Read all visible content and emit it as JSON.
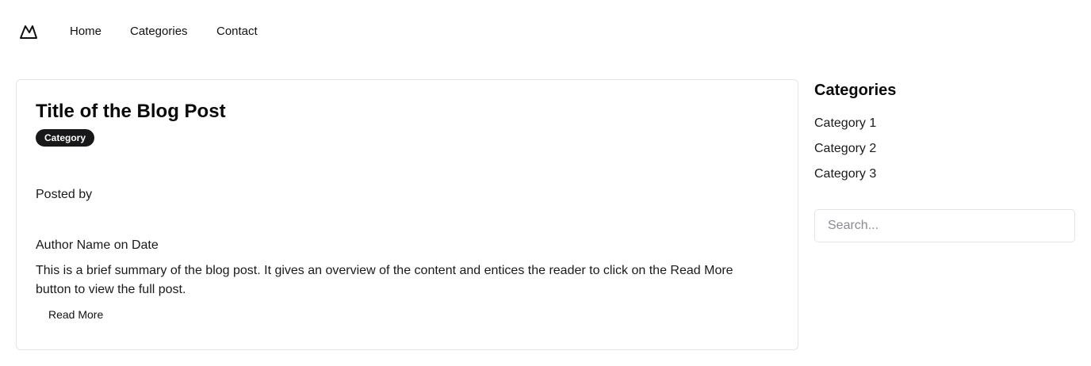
{
  "nav": {
    "logo_icon": "mountain-logo-icon",
    "links": [
      "Home",
      "Categories",
      "Contact"
    ]
  },
  "post": {
    "title": "Title of the Blog Post",
    "category_badge": "Category",
    "posted_by": "Posted by",
    "author_date": "Author Name on Date",
    "summary": "This is a brief summary of the blog post. It gives an overview of the content and entices the reader to click on the Read More button to view the full post.",
    "read_more_label": "Read More"
  },
  "sidebar": {
    "title": "Categories",
    "categories": [
      "Category 1",
      "Category 2",
      "Category 3"
    ],
    "search_placeholder": "Search..."
  },
  "colors": {
    "badge_bg": "#18181b",
    "border": "#e4e4e7",
    "text": "#111111"
  }
}
